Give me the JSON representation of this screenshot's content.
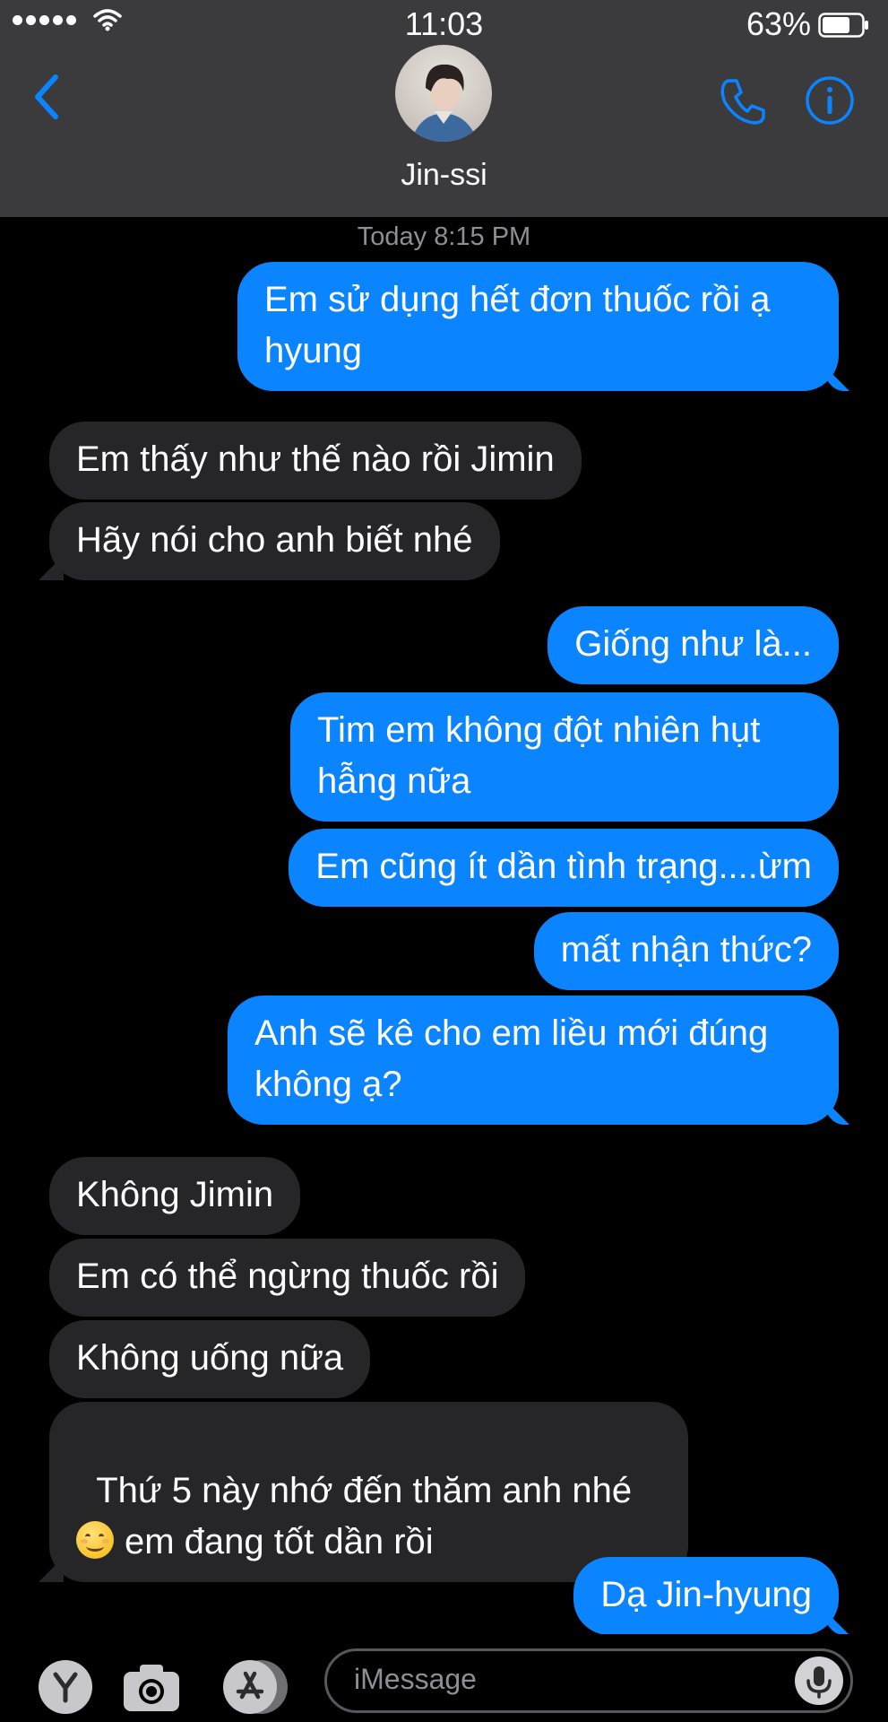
{
  "status_bar": {
    "time": "11:03",
    "battery_percent": "63%",
    "signal_bars": 5
  },
  "header": {
    "contact_name": "Jin-ssi"
  },
  "conversation": {
    "timestamp": "Today 8:15 PM",
    "messages": [
      {
        "from": "me",
        "text": "Em sử dụng hết đơn thuốc rồi ạ\nhyung"
      },
      {
        "from": "them",
        "text": "Em thấy như thế nào rồi Jimin"
      },
      {
        "from": "them",
        "text": "Hãy nói cho anh biết nhé"
      },
      {
        "from": "me",
        "text": "Giống như là..."
      },
      {
        "from": "me",
        "text": "Tim em không đột nhiên hụt\nhẫng nữa"
      },
      {
        "from": "me",
        "text": "Em cũng ít dần tình trạng....ừm"
      },
      {
        "from": "me",
        "text": "mất nhận thức?"
      },
      {
        "from": "me",
        "text": "Anh sẽ kê cho em liều mới đúng\nkhông ạ?"
      },
      {
        "from": "them",
        "text": "Không Jimin"
      },
      {
        "from": "them",
        "text": "Em có thể ngừng thuốc rồi"
      },
      {
        "from": "them",
        "text": "Không uống nữa"
      },
      {
        "from": "them",
        "text_line1": "Thứ 5 này nhớ đến thăm anh nhé",
        "text_line2": "em đang tốt dần rồi",
        "emoji": "smiling-face-emoji"
      },
      {
        "from": "me",
        "text": "Dạ Jin-hyung"
      }
    ]
  },
  "input_bar": {
    "placeholder": "iMessage"
  },
  "colors": {
    "header_bg": "#3b3b3d",
    "accent_blue": "#0a84ff",
    "outgoing_bubble": "#0a84ff",
    "incoming_bubble": "#262628",
    "timestamp_gray": "#8e8e93"
  },
  "icons": [
    "signal-dots-icon",
    "wifi-icon",
    "battery-icon",
    "back-chevron-icon",
    "phone-icon",
    "info-icon",
    "camera-icon",
    "app-store-icon",
    "y-app-icon",
    "microphone-icon"
  ]
}
